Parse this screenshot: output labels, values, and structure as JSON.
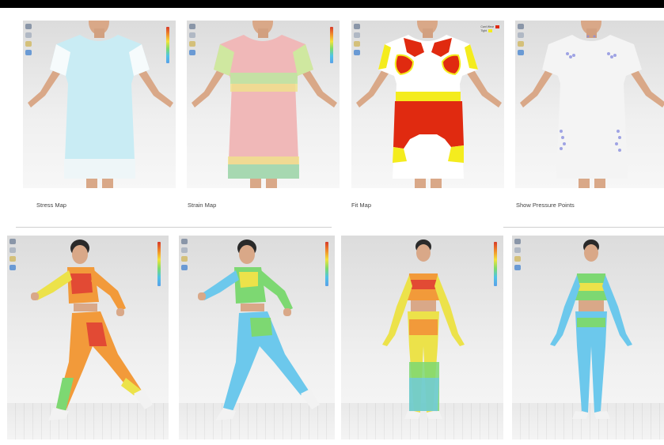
{
  "captions": {
    "stress": "Stress Map",
    "strain": "Strain Map",
    "fit": "Fit Map",
    "pressure": "Show Pressure Points"
  },
  "fit_legend": {
    "labels": [
      "Cant Wear",
      "Tight"
    ],
    "colors": [
      "#e02a10",
      "#f4ec1e"
    ]
  },
  "colors": {
    "stress_garment": "#c9ecf4",
    "strain_garment": "#f0b8b8",
    "heat_red": "#e24a34",
    "heat_orange": "#f29a3a",
    "heat_yellow": "#ece24a",
    "heat_green": "#7dd872",
    "heat_blue": "#6cc8ec",
    "skin": "#d9a888",
    "hair": "#2a2a2a"
  },
  "icons": [
    "toolbar-icon",
    "color-scale-icon"
  ]
}
